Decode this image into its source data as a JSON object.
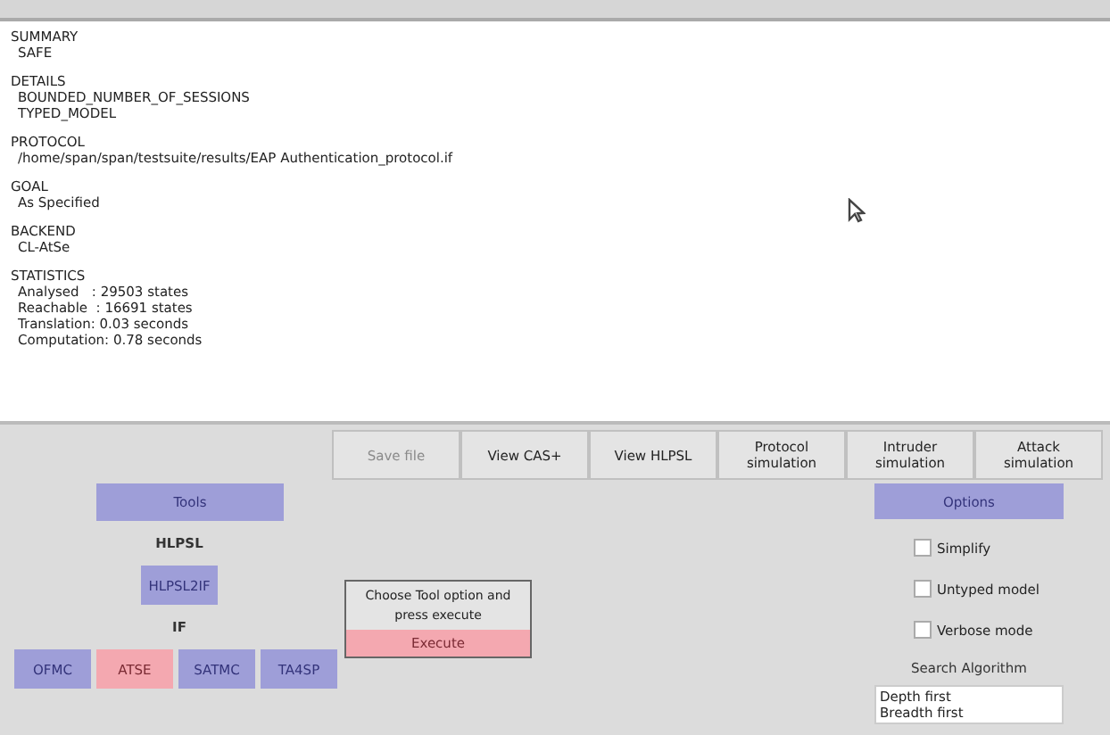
{
  "output": {
    "sections": [
      {
        "heading": "SUMMARY",
        "lines": [
          "SAFE"
        ]
      },
      {
        "heading": "DETAILS",
        "lines": [
          "BOUNDED_NUMBER_OF_SESSIONS",
          "TYPED_MODEL"
        ]
      },
      {
        "heading": "PROTOCOL",
        "lines": [
          "/home/span/span/testsuite/results/EAP Authentication_protocol.if"
        ]
      },
      {
        "heading": "GOAL",
        "lines": [
          "As Specified"
        ]
      },
      {
        "heading": "BACKEND",
        "lines": [
          "CL-AtSe"
        ]
      },
      {
        "heading": "STATISTICS",
        "lines": [
          "Analysed   : 29503 states",
          "Reachable  : 16691 states",
          "Translation: 0.03 seconds",
          "Computation: 0.78 seconds"
        ]
      }
    ]
  },
  "actions": [
    {
      "label": "Save file",
      "disabled": true
    },
    {
      "label": "View CAS+",
      "disabled": false
    },
    {
      "label": "View HLPSL",
      "disabled": false
    },
    {
      "label": "Protocol simulation",
      "disabled": false
    },
    {
      "label": "Intruder simulation",
      "disabled": false
    },
    {
      "label": "Attack simulation",
      "disabled": false
    }
  ],
  "tools": {
    "title": "Tools",
    "input_label": "HLPSL",
    "translator": "HLPSL2IF",
    "output_label": "IF",
    "backends": [
      {
        "label": "OFMC",
        "selected": false
      },
      {
        "label": "ATSE",
        "selected": true
      },
      {
        "label": "SATMC",
        "selected": false
      },
      {
        "label": "TA4SP",
        "selected": false
      }
    ]
  },
  "execute": {
    "message": "Choose Tool option and press execute",
    "button": "Execute"
  },
  "options": {
    "title": "Options",
    "checkboxes": [
      {
        "label": "Simplify",
        "checked": false
      },
      {
        "label": "Untyped model",
        "checked": false
      },
      {
        "label": "Verbose mode",
        "checked": false
      }
    ],
    "search_label": "Search Algorithm",
    "algorithms": [
      "Depth first",
      "Breadth first"
    ]
  }
}
